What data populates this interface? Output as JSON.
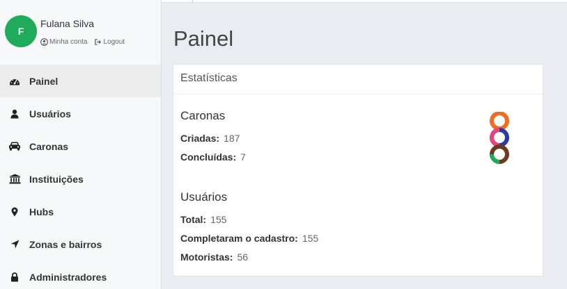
{
  "user": {
    "initial": "F",
    "name": "Fulana Silva",
    "account_label": "Minha conta",
    "logout_label": "Logout"
  },
  "nav": {
    "items": [
      {
        "label": "Painel",
        "icon": "dashboard-icon"
      },
      {
        "label": "Usuários",
        "icon": "user-icon"
      },
      {
        "label": "Caronas",
        "icon": "car-icon"
      },
      {
        "label": "Instituições",
        "icon": "institution-icon"
      },
      {
        "label": "Hubs",
        "icon": "map-marker-icon"
      },
      {
        "label": "Zonas e bairros",
        "icon": "location-arrow-icon"
      },
      {
        "label": "Administradores",
        "icon": "lock-icon"
      }
    ]
  },
  "page": {
    "title": "Painel"
  },
  "stats": {
    "header": "Estatísticas",
    "caronas": {
      "title": "Caronas",
      "criadas_label": "Criadas:",
      "criadas_value": "187",
      "concluidas_label": "Concluídas:",
      "concluidas_value": "7"
    },
    "usuarios": {
      "title": "Usuários",
      "total_label": "Total:",
      "total_value": "155",
      "completaram_label": "Completaram o cadastro:",
      "completaram_value": "155",
      "motoristas_label": "Motoristas:",
      "motoristas_value": "56"
    }
  },
  "colors": {
    "avatar": "#1faa5c",
    "logo": [
      "#f26b21",
      "#e5467d",
      "#2b3aa0",
      "#1faa5c",
      "#6b3a1e"
    ]
  }
}
